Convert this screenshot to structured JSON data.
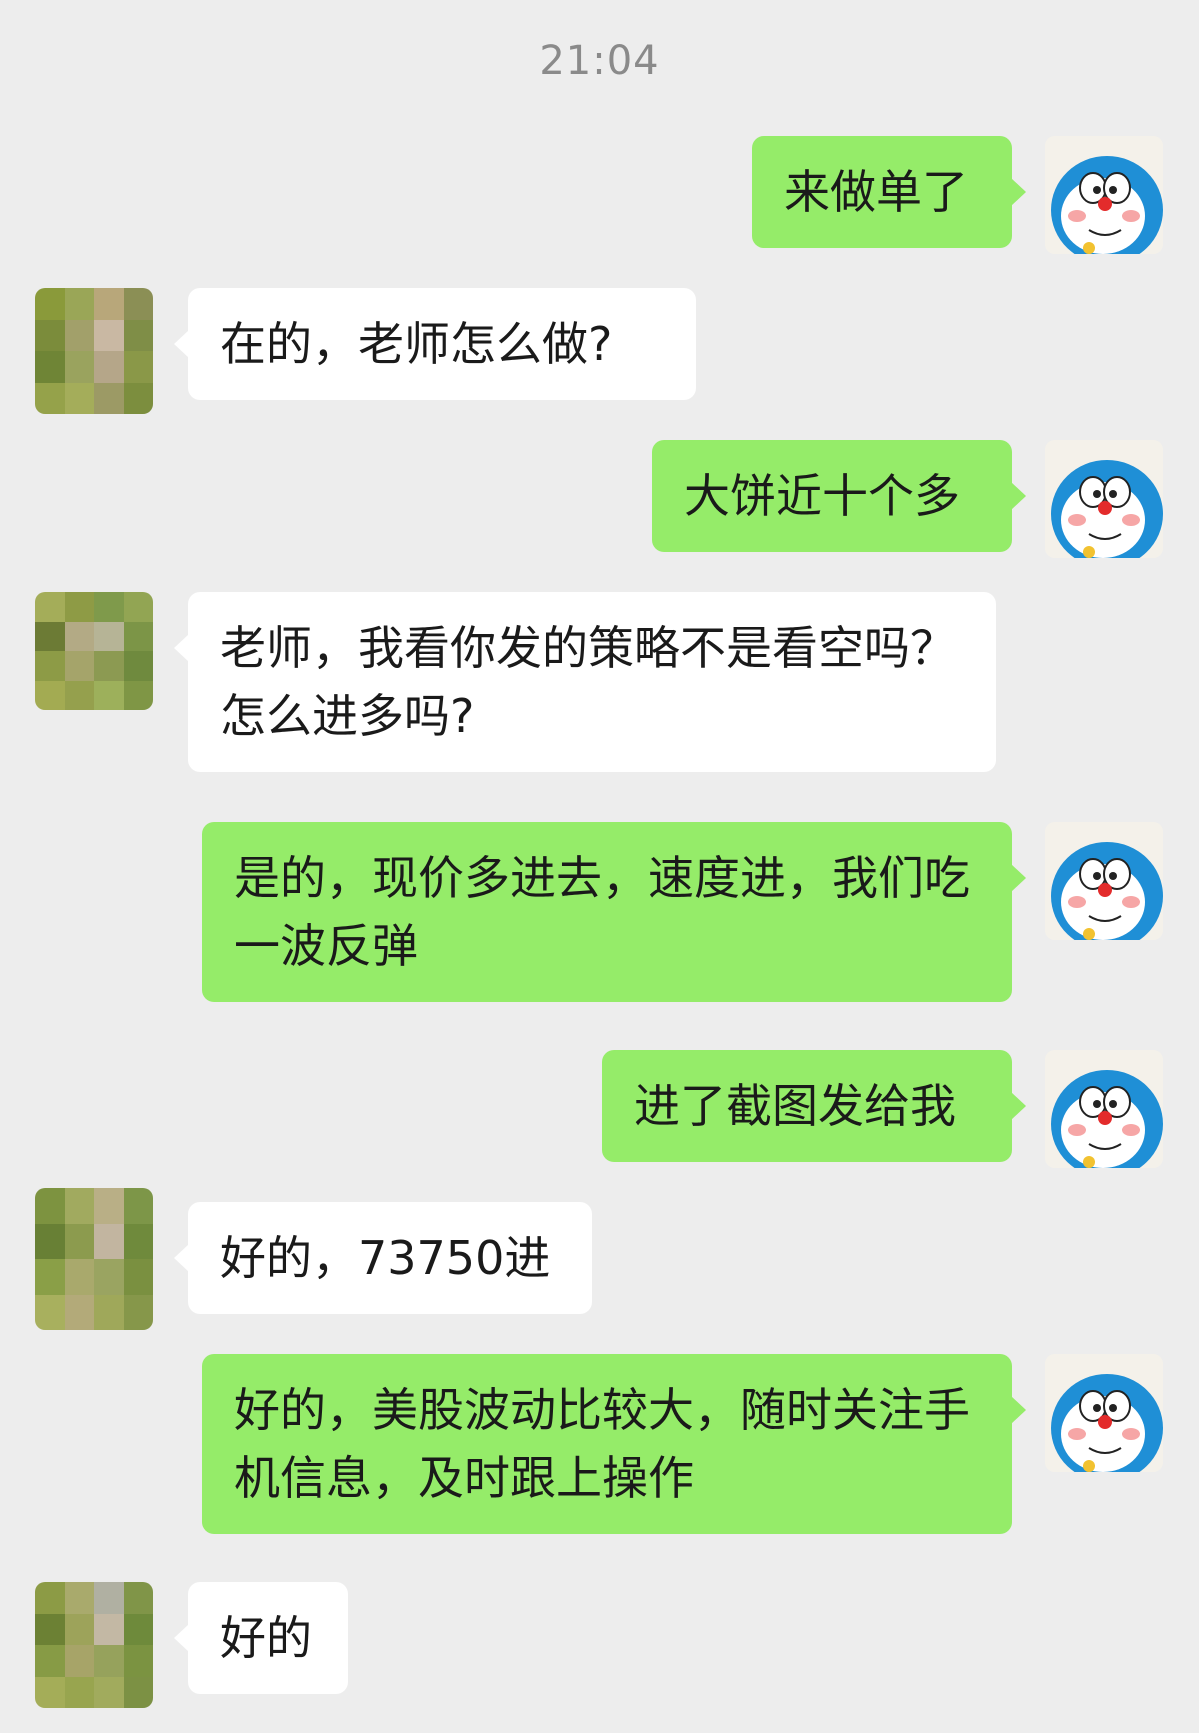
{
  "time": "21:04",
  "messages": [
    {
      "from": "self",
      "text": "来做单了"
    },
    {
      "from": "other",
      "text": "在的，老师怎么做?"
    },
    {
      "from": "self",
      "text": "大饼近十个多"
    },
    {
      "from": "other",
      "text": "老师，我看你发的策略不是看空吗？怎么进多吗?"
    },
    {
      "from": "self",
      "text": "是的，现价多进去，速度进，我们吃一波反弹"
    },
    {
      "from": "self",
      "text": "进了截图发给我"
    },
    {
      "from": "other",
      "text": "好的，73750进"
    },
    {
      "from": "self",
      "text": "好的，美股波动比较大，随时关注手机信息，及时跟上操作"
    },
    {
      "from": "other",
      "text": "好的"
    }
  ],
  "avatars": {
    "self_icon": "cartoon-cat-avatar-icon",
    "other_icon": "pixelated-photo-avatar"
  }
}
